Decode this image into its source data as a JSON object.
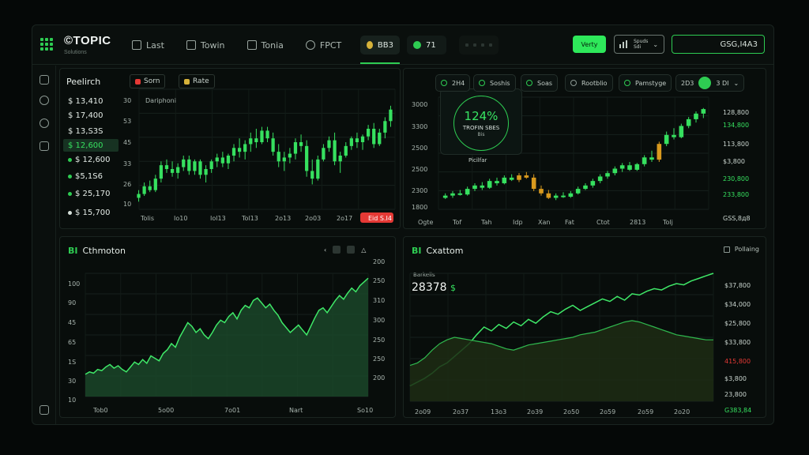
{
  "brand": {
    "name": "©TOPIC",
    "sub": "Solutions"
  },
  "nav": [
    {
      "label": "Last",
      "icon": "bank-icon"
    },
    {
      "label": "Towin",
      "icon": "wallet-icon"
    },
    {
      "label": "Tonia",
      "icon": "chart-icon"
    },
    {
      "label": "FPCT",
      "icon": "globe-icon"
    }
  ],
  "pills": {
    "coin": "BB3",
    "status": "71"
  },
  "actions": {
    "primary": "Verty",
    "menu_line1": "Spuds",
    "menu_line2": "Sdi",
    "balance": "GSG,I4A3"
  },
  "colors": {
    "accent": "#2ecc52",
    "negative": "#e53935",
    "warning": "#d99a1e",
    "background": "#0a0f0d"
  },
  "watchlist": {
    "title": "Peelirch",
    "chip_sort": "Sorn",
    "chip_rate": "Rate",
    "items": [
      "$ 13,410",
      "$ 17,400",
      "$ 13,S3S",
      "$ 12,600",
      "$ 12,600",
      "$5,1S6",
      "$ 25,170",
      "$ 15,700"
    ]
  },
  "panel_candles": {
    "header": "Dariphoni",
    "chart_data": {
      "type": "candlestick",
      "yticks": [
        "30",
        "53",
        "45",
        "33",
        "26",
        "10"
      ],
      "xticks": [
        "Tolis",
        "Io10",
        "Iol13",
        "Tol13",
        "2o13",
        "2o03",
        "2o17"
      ],
      "badge": "Eid S.I4",
      "ohlc": [
        [
          14,
          18,
          12,
          16
        ],
        [
          16,
          22,
          15,
          20
        ],
        [
          20,
          23,
          17,
          18
        ],
        [
          18,
          26,
          17,
          24
        ],
        [
          24,
          33,
          22,
          31
        ],
        [
          31,
          34,
          27,
          29
        ],
        [
          29,
          33,
          25,
          27
        ],
        [
          27,
          32,
          24,
          30
        ],
        [
          30,
          36,
          28,
          34
        ],
        [
          34,
          36,
          26,
          28
        ],
        [
          28,
          34,
          26,
          33
        ],
        [
          33,
          34,
          24,
          26
        ],
        [
          26,
          31,
          22,
          29
        ],
        [
          29,
          34,
          27,
          33
        ],
        [
          33,
          37,
          30,
          35
        ],
        [
          35,
          38,
          30,
          32
        ],
        [
          32,
          37,
          29,
          36
        ],
        [
          36,
          42,
          33,
          40
        ],
        [
          40,
          45,
          35,
          38
        ],
        [
          38,
          44,
          34,
          42
        ],
        [
          42,
          48,
          38,
          45
        ],
        [
          45,
          50,
          40,
          43
        ],
        [
          43,
          51,
          42,
          49
        ],
        [
          49,
          51,
          43,
          45
        ],
        [
          45,
          48,
          36,
          38
        ],
        [
          38,
          42,
          30,
          33
        ],
        [
          33,
          38,
          28,
          35
        ],
        [
          35,
          40,
          32,
          37
        ],
        [
          37,
          45,
          34,
          43
        ],
        [
          43,
          47,
          38,
          41
        ],
        [
          41,
          44,
          25,
          28
        ],
        [
          28,
          34,
          21,
          24
        ],
        [
          24,
          36,
          23,
          34
        ],
        [
          34,
          42,
          33,
          40
        ],
        [
          40,
          46,
          38,
          44
        ],
        [
          44,
          48,
          31,
          33
        ],
        [
          33,
          38,
          27,
          36
        ],
        [
          36,
          43,
          35,
          41
        ],
        [
          41,
          46,
          39,
          45
        ],
        [
          45,
          48,
          40,
          43
        ],
        [
          43,
          47,
          39,
          46
        ],
        [
          46,
          52,
          44,
          50
        ],
        [
          50,
          53,
          40,
          42
        ],
        [
          42,
          50,
          41,
          48
        ],
        [
          48,
          56,
          45,
          54
        ],
        [
          54,
          62,
          51,
          60
        ]
      ]
    }
  },
  "panel_stat": {
    "value": "124%",
    "label": "TROFIN SBES",
    "sub": "Bis",
    "caption": "Picilfar",
    "chips": [
      "2H4",
      "Soshis",
      "Soas",
      "Rootblio",
      "Pamstyge",
      "2D3",
      "3 DI"
    ],
    "chart_data": {
      "type": "candlestick",
      "yticks": [
        "3000",
        "3300",
        "2500",
        "2500",
        "2300",
        "1800"
      ],
      "xticks": [
        "Ogte",
        "Tof",
        "Tah",
        "Idp",
        "Xan",
        "Fat",
        "Ctot",
        "2813",
        "Tolj"
      ],
      "right_ticks": [
        "128,800",
        "134,800",
        "113,800",
        "$3,800",
        "230,800",
        "233,800",
        "GSS,8д8"
      ],
      "ohlc": [
        [
          20,
          24,
          19,
          22
        ],
        [
          22,
          26,
          20,
          24
        ],
        [
          24,
          27,
          22,
          23
        ],
        [
          23,
          30,
          22,
          28
        ],
        [
          28,
          33,
          26,
          31
        ],
        [
          31,
          34,
          27,
          29
        ],
        [
          29,
          37,
          28,
          35
        ],
        [
          35,
          38,
          31,
          33
        ],
        [
          33,
          40,
          32,
          38
        ],
        [
          38,
          41,
          35,
          36
        ],
        [
          36,
          42,
          34,
          40
        ],
        [
          40,
          43,
          37,
          38
        ],
        [
          38,
          41,
          26,
          28
        ],
        [
          28,
          31,
          22,
          24
        ],
        [
          24,
          27,
          19,
          20
        ],
        [
          20,
          24,
          18,
          22
        ],
        [
          22,
          25,
          20,
          21
        ],
        [
          21,
          26,
          20,
          24
        ],
        [
          24,
          30,
          23,
          28
        ],
        [
          28,
          33,
          27,
          31
        ],
        [
          31,
          37,
          29,
          35
        ],
        [
          35,
          41,
          33,
          39
        ],
        [
          39,
          44,
          37,
          42
        ],
        [
          42,
          48,
          40,
          46
        ],
        [
          46,
          51,
          43,
          49
        ],
        [
          49,
          52,
          44,
          45
        ],
        [
          45,
          51,
          44,
          50
        ],
        [
          50,
          58,
          48,
          56
        ],
        [
          56,
          62,
          52,
          54
        ],
        [
          54,
          70,
          52,
          68
        ],
        [
          68,
          79,
          66,
          76
        ],
        [
          76,
          82,
          72,
          74
        ],
        [
          74,
          86,
          73,
          84
        ],
        [
          84,
          92,
          82,
          90
        ],
        [
          90,
          97,
          87,
          95
        ],
        [
          95,
          100,
          91,
          99
        ]
      ]
    }
  },
  "panel_area": {
    "title": "Cthmoton",
    "mark": "BI",
    "chart_data": {
      "type": "area",
      "yticks_left": [
        "100",
        "90",
        "45",
        "65",
        "1S",
        "30",
        "10"
      ],
      "yticks_right": [
        "200",
        "250",
        "310",
        "300",
        "250",
        "250",
        "200"
      ],
      "xticks": [
        "Tob0",
        "5o00",
        "7o01",
        "Nart",
        "So10"
      ],
      "values": [
        18,
        20,
        19,
        22,
        21,
        24,
        26,
        23,
        25,
        22,
        20,
        24,
        28,
        26,
        30,
        27,
        33,
        31,
        29,
        35,
        38,
        43,
        40,
        48,
        54,
        60,
        57,
        52,
        55,
        50,
        47,
        52,
        58,
        62,
        60,
        65,
        68,
        63,
        70,
        74,
        72,
        78,
        80,
        76,
        72,
        75,
        70,
        66,
        60,
        56,
        52,
        55,
        58,
        54,
        50,
        57,
        64,
        70,
        72,
        68,
        73,
        78,
        82,
        79,
        84,
        88,
        85,
        90,
        93,
        96
      ]
    }
  },
  "panel_line": {
    "title": "Cxattom",
    "mark": "BI",
    "value_label": "Barkeiis",
    "value": "28378",
    "currency": "$",
    "legend": "Pollaing",
    "chart_data": {
      "type": "line",
      "yticks": [
        "$37,800",
        "$34,000",
        "$25,800",
        "$33,800",
        "415,800",
        "$3,800",
        "23,800",
        "G383,84"
      ],
      "xticks": [
        "2o09",
        "2o37",
        "13o3",
        "2o39",
        "2o50",
        "2o59",
        "2o59",
        "2o20"
      ],
      "series": [
        {
          "values": [
            12,
            15,
            18,
            22,
            27,
            30,
            35,
            40,
            45,
            52,
            58,
            55,
            60,
            57,
            62,
            59,
            64,
            61,
            66,
            70,
            68,
            72,
            75,
            71,
            74,
            77,
            80,
            78,
            82,
            79,
            84,
            83,
            86,
            88,
            87,
            90,
            92,
            91,
            94,
            96,
            98,
            100
          ]
        },
        {
          "values": [
            28,
            30,
            34,
            40,
            45,
            48,
            50,
            49,
            48,
            47,
            46,
            45,
            43,
            41,
            40,
            42,
            44,
            45,
            46,
            47,
            48,
            49,
            50,
            52,
            53,
            54,
            56,
            58,
            60,
            62,
            63,
            62,
            60,
            58,
            56,
            54,
            52,
            51,
            50,
            49,
            48,
            48
          ]
        }
      ]
    }
  }
}
